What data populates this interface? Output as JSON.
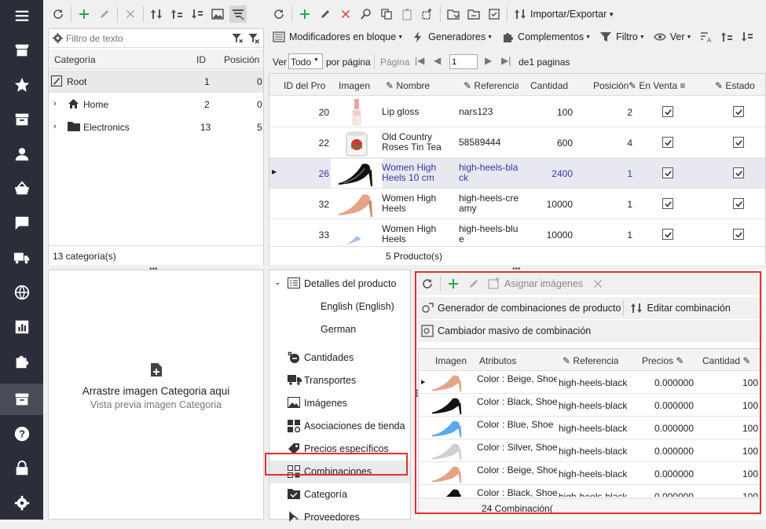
{
  "left_toolbar": {
    "filter_placeholder": "Filtro de texto"
  },
  "category_table": {
    "columns": [
      "Categoría",
      "ID",
      "Posición"
    ],
    "rows": [
      {
        "name": "Root",
        "id": "1",
        "pos": "0"
      },
      {
        "name": "Home",
        "id": "2",
        "pos": "0"
      },
      {
        "name": "Electronics",
        "id": "13",
        "pos": "5"
      }
    ],
    "footer": "13 categoría(s)"
  },
  "image_drop": {
    "main": "Arrastre imagen Categoria aqui",
    "sub": "Vista previa imagen Categoria"
  },
  "top_toolbar": {
    "import_export": "Importar/Exportar"
  },
  "second_toolbar": {
    "bulk": "Modificadores en bloque",
    "generators": "Generadores",
    "addons": "Complementos",
    "filter": "Filtro",
    "view": "Ver"
  },
  "pager": {
    "ver": "Ver",
    "todo": "Todo",
    "per_page": "por página",
    "page": "Página",
    "page_num": "1",
    "of": "de1 paginas"
  },
  "product_table": {
    "columns": [
      "ID del Pro",
      "Imagen",
      "Nombre",
      "Referencia",
      "Cantidad",
      "Posición",
      "En Venta",
      "Estado"
    ],
    "rows": [
      {
        "id": "20",
        "name": "Lip gloss",
        "ref": "nars123",
        "qty": "100",
        "pos": "2"
      },
      {
        "id": "22",
        "name": "Old Country Roses Tin Tea",
        "ref": "58589444",
        "qty": "600",
        "pos": "4"
      },
      {
        "id": "26",
        "name": "Women High Heels 10 cm",
        "ref": "high-heels-black",
        "qty": "2400",
        "pos": "1"
      },
      {
        "id": "32",
        "name": "Women High Heels",
        "ref": "high-heels-creamy",
        "qty": "10000",
        "pos": "1"
      },
      {
        "id": "33",
        "name": "Women High Heels",
        "ref": "high-heels-blue",
        "qty": "10000",
        "pos": "1"
      }
    ],
    "footer": "5 Producto(s)"
  },
  "detail_menu": {
    "header": "Detalles del producto",
    "lang1": "English (English)",
    "lang2": "German",
    "items": [
      "Cantidades",
      "Transportes",
      "Imágenes",
      "Asociaciones de tienda",
      "Precios específicos",
      "Combinaciones",
      "Categoría",
      "Proveedores"
    ]
  },
  "combo_panel": {
    "assign": "Asignar imágenes",
    "generator": "Generador de combinaciones de producto",
    "edit": "Editar combinación",
    "mass": "Cambiador masivo de combinación",
    "columns": [
      "Imagen",
      "Atributos",
      "Referencia",
      "Precios",
      "Cantidad"
    ],
    "rows": [
      {
        "attr": "Color : Beige, Shoe",
        "ref": "high-heels-black",
        "price": "0.000000",
        "qty": "100"
      },
      {
        "attr": "Color : Black, Shoe",
        "ref": "high-heels-black",
        "price": "0.000000",
        "qty": "100"
      },
      {
        "attr": "Color : Blue, Shoe",
        "ref": "high-heels-black",
        "price": "0.000000",
        "qty": "100"
      },
      {
        "attr": "Color : Silver, Shoe",
        "ref": "high-heels-black",
        "price": "0.000000",
        "qty": "100"
      },
      {
        "attr": "Color : Beige, Shoe",
        "ref": "high-heels-black",
        "price": "0.000000",
        "qty": "100"
      },
      {
        "attr": "Color : Black, Shoe",
        "ref": "high-heels-black",
        "price": "0.000000",
        "qty": "100"
      }
    ],
    "footer": "24 Combinación("
  },
  "colors": {
    "sidebar": "#2b2e38",
    "accent_red": "#e03030",
    "selected_text": "#3a36a8",
    "green": "#2ea44f"
  }
}
